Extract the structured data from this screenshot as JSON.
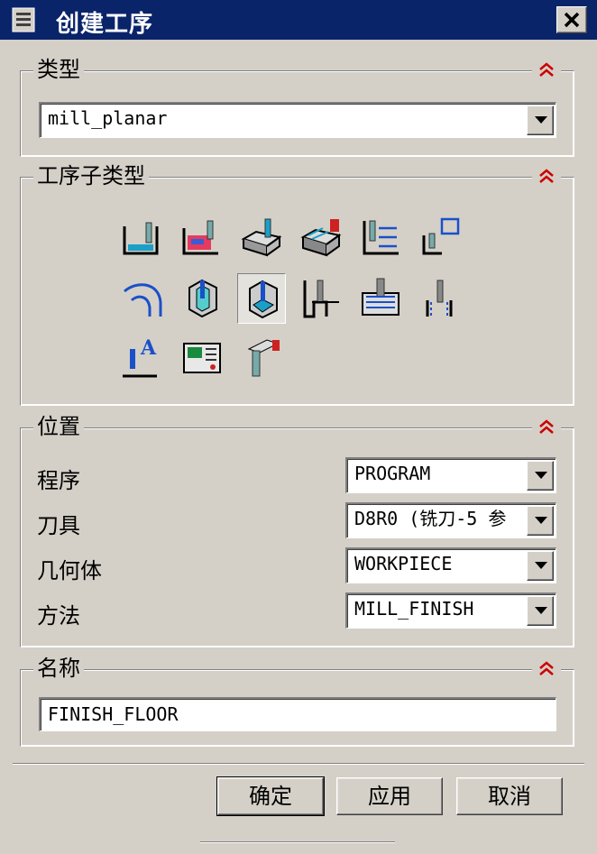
{
  "window": {
    "title": "创建工序",
    "close_icon": "close-icon"
  },
  "type_group": {
    "title": "类型",
    "selected": "mill_planar"
  },
  "subtype_group": {
    "title": "工序子类型",
    "icons": [
      "floor-wall-icon",
      "floor-wall-ipw-icon",
      "face-milling-icon",
      "face-milling-manual-icon",
      "planar-profile-icon",
      "planar-mill-icon",
      "cavity-trace-icon",
      "fin-wall-icon",
      "finish-floor-icon",
      "groove-milling-icon",
      "hole-milling-icon",
      "thread-milling-icon",
      "planar-text-icon",
      "mill-control-icon",
      "mill-user-icon"
    ],
    "selected_index": 8
  },
  "location_group": {
    "title": "位置",
    "rows": [
      {
        "label": "程序",
        "value": "PROGRAM"
      },
      {
        "label": "刀具",
        "value": "D8R0 (铣刀-5 参"
      },
      {
        "label": "几何体",
        "value": "WORKPIECE"
      },
      {
        "label": "方法",
        "value": "MILL_FINISH"
      }
    ]
  },
  "name_group": {
    "title": "名称",
    "value": "FINISH_FLOOR"
  },
  "buttons": {
    "ok": "确定",
    "apply": "应用",
    "cancel": "取消"
  },
  "colors": {
    "titlebar": "#0a246a",
    "collapse_arrow": "#cc0000",
    "dialog_bg": "#d4d0c8"
  }
}
